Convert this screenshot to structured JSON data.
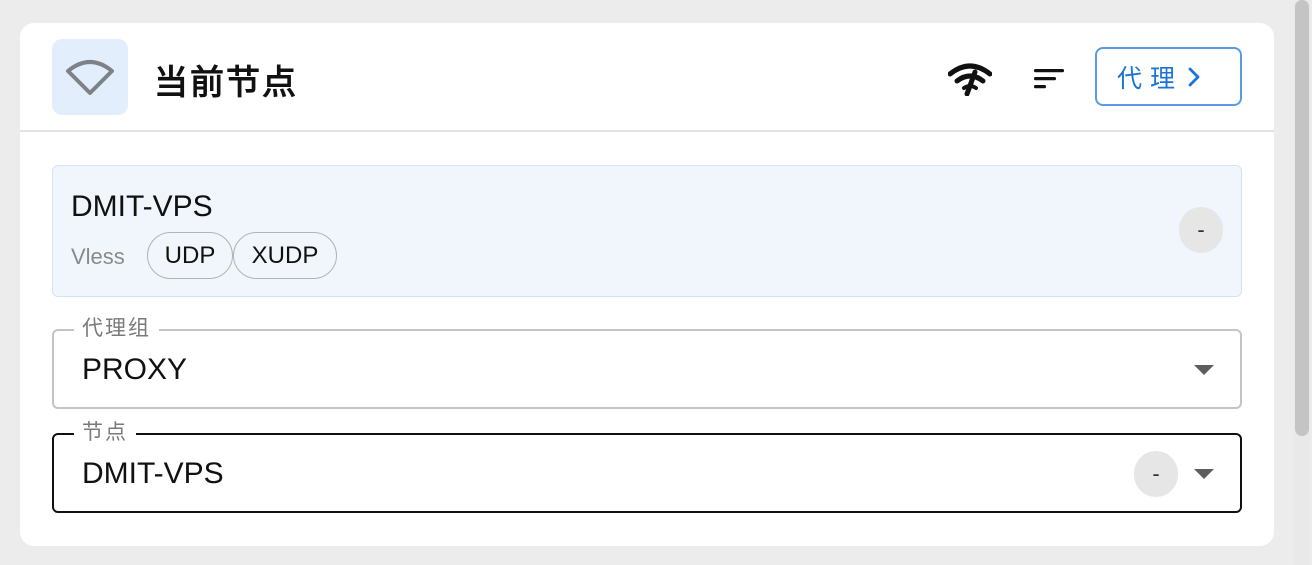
{
  "header": {
    "title": "当前节点",
    "wifi_icon": "wifi-icon",
    "speed_icon": "network-check-icon",
    "sort_icon": "sort-icon",
    "proxy_button_label": "代理",
    "proxy_button_icon": "chevron-right-icon",
    "accent_color": "#1a74d8"
  },
  "current_node": {
    "name": "DMIT-VPS",
    "type": "Vless",
    "tags": [
      "UDP",
      "XUDP"
    ],
    "delay": "-"
  },
  "proxy_group_select": {
    "label": "代理组",
    "value": "PROXY"
  },
  "node_select": {
    "label": "节点",
    "value": "DMIT-VPS",
    "delay": "-"
  }
}
